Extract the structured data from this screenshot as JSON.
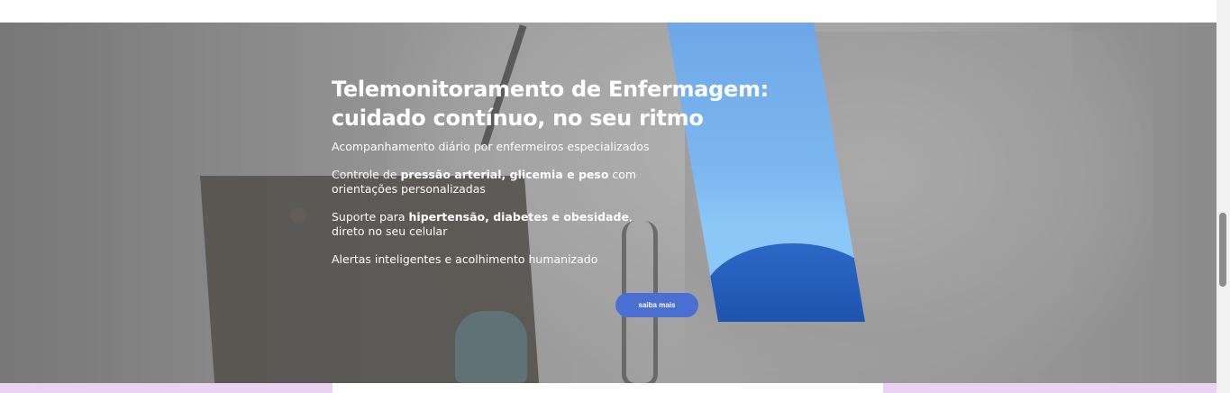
{
  "hero": {
    "title": "Telemonitoramento de Enfermagem: cuidado contínuo, no seu ritmo",
    "items": [
      {
        "parts": [
          {
            "text": "Acompanhamento diário por enfermeiros especializados",
            "bold": false
          }
        ]
      },
      {
        "parts": [
          {
            "text": "Controle de ",
            "bold": false
          },
          {
            "text": "pressão arterial, glicemia e peso",
            "bold": true
          },
          {
            "text": " com orientações personalizadas",
            "bold": false
          }
        ]
      },
      {
        "parts": [
          {
            "text": "Suporte para ",
            "bold": false
          },
          {
            "text": "hipertensão, diabetes e obesidade",
            "bold": true
          },
          {
            "text": ", direto no seu celular",
            "bold": false
          }
        ]
      },
      {
        "parts": [
          {
            "text": "Alertas inteligentes e acolhimento humanizado",
            "bold": false
          }
        ]
      }
    ],
    "cta_label": "saiba mais"
  },
  "colors": {
    "accent_button": "#4a6fd2",
    "band_pink": "#ead2f2",
    "banner_blue": "#7cb8ef",
    "dome_blue": "#2b68c6"
  }
}
